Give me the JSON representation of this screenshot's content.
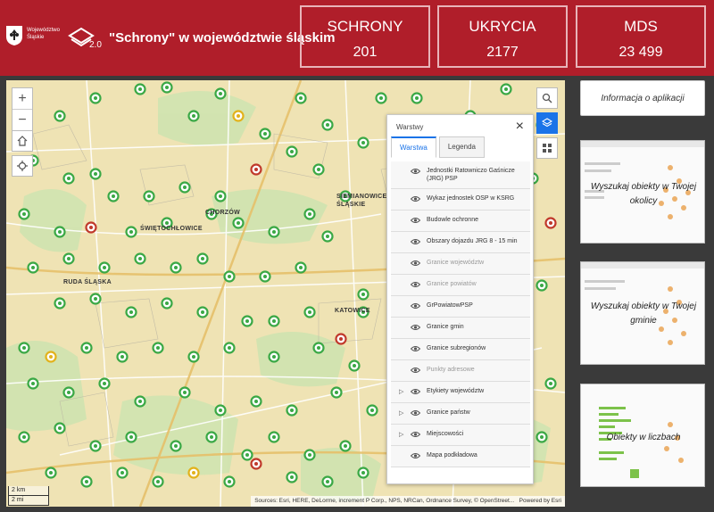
{
  "header": {
    "logo_text": "Województwo Śląskie",
    "version": "2.0",
    "title": "\"Schrony\" w województwie śląskim"
  },
  "stats": [
    {
      "label": "SCHRONY",
      "value": "201"
    },
    {
      "label": "UKRYCIA",
      "value": "2177"
    },
    {
      "label": "MDS",
      "value": "23 499"
    }
  ],
  "map": {
    "zoom_in": "+",
    "zoom_out": "−",
    "labels": [
      "CHORZÓW",
      "ŚWIĘTOCHŁOWICE",
      "RUDA ŚLĄSKA",
      "KATOWICE",
      "SIEMIANOWICE ŚLĄSKIE"
    ],
    "scale_km": "2 km",
    "scale_mi": "2 mi",
    "attribution": "Sources: Esri, HERE, DeLorme, increment P Corp., NPS, NRCan, Ordnance Survey, © OpenStreet...",
    "powered_by": "Powered by Esri"
  },
  "layers_panel": {
    "title": "Warstwy",
    "tabs": [
      "Warstwa",
      "Legenda"
    ],
    "items": [
      {
        "label": "Jednostki Ratowniczo Gaśnicze (JRG) PSP",
        "dim": false,
        "expandable": false
      },
      {
        "label": "Wykaz jednostek OSP w KSRG",
        "dim": false,
        "expandable": false
      },
      {
        "label": "Budowle ochronne",
        "dim": false,
        "expandable": false
      },
      {
        "label": "Obszary dojazdu JRG 8 - 15 min",
        "dim": false,
        "expandable": false
      },
      {
        "label": "Granice województw",
        "dim": true,
        "expandable": false
      },
      {
        "label": "Granice powiatów",
        "dim": true,
        "expandable": false
      },
      {
        "label": "GrPowiatowPSP",
        "dim": false,
        "expandable": false
      },
      {
        "label": "Granice gmin",
        "dim": false,
        "expandable": false
      },
      {
        "label": "Granice subregionów",
        "dim": false,
        "expandable": false
      },
      {
        "label": "Punkty adresowe",
        "dim": true,
        "expandable": false
      },
      {
        "label": "Etykiety województw",
        "dim": false,
        "expandable": true
      },
      {
        "label": "Granice państw",
        "dim": false,
        "expandable": true
      },
      {
        "label": "Miejscowości",
        "dim": false,
        "expandable": true
      },
      {
        "label": "Mapa podkładowa",
        "dim": false,
        "expandable": false
      }
    ]
  },
  "sidebar": {
    "info_button": "Informacja o aplikacji",
    "cards": [
      {
        "label": "Wyszukaj obiekty w Twojej okolicy"
      },
      {
        "label": "Wyszukaj obiekty w Twojej gminie"
      },
      {
        "label": "Obiekty w liczbach"
      }
    ]
  },
  "colors": {
    "header_red": "#b01e2a",
    "marker_green": "#3aa845",
    "marker_red": "#c0392b",
    "marker_yellow": "#e2b21b",
    "accent_blue": "#1a73e8"
  }
}
